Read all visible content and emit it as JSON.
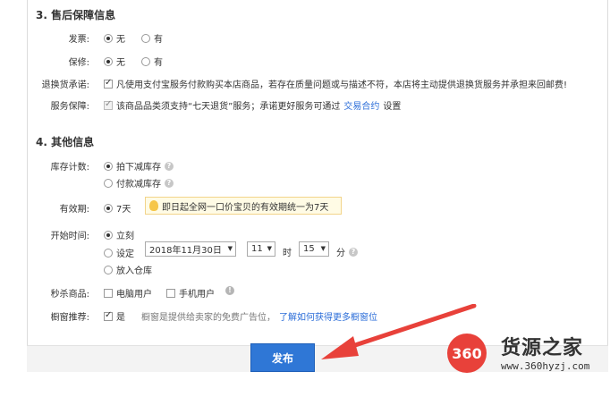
{
  "section3": {
    "title": "3. 售后保障信息",
    "invoice": {
      "label": "发票:",
      "opt_no": "无",
      "opt_yes": "有"
    },
    "warranty": {
      "label": "保修:",
      "opt_no": "无",
      "opt_yes": "有"
    },
    "return_promise": {
      "label": "退换货承诺:",
      "text": "凡使用支付宝服务付款购买本店商品，若存在质量问题或与描述不符，本店将主动提供退换货服务并承担来回邮费!"
    },
    "service": {
      "label": "服务保障:",
      "text_before": "该商品品类须支持“七天退货”服务；承诺更好服务可通过",
      "link": "交易合约",
      "text_after": "设置"
    }
  },
  "section4": {
    "title": "4. 其他信息",
    "stock": {
      "label": "库存计数:",
      "opt1": "拍下减库存",
      "opt2": "付款减库存"
    },
    "validity": {
      "label": "有效期:",
      "opt": "7天",
      "tip": "即日起全网一口价宝贝的有效期统一为7天"
    },
    "start_time": {
      "label": "开始时间:",
      "opt_now": "立刻",
      "opt_set": "设定",
      "date": "2018年11月30日",
      "hour": "11",
      "hour_unit": "时",
      "minute": "15",
      "minute_unit": "分",
      "opt_warehouse": "放入仓库"
    },
    "flash_sale": {
      "label": "秒杀商品:",
      "opt_pc": "电脑用户",
      "opt_mobile": "手机用户"
    },
    "window": {
      "label": "橱窗推荐:",
      "opt": "是",
      "desc": "橱窗是提供给卖家的免费广告位，",
      "link": "了解如何获得更多橱窗位"
    }
  },
  "footer": {
    "publish_label": "发布"
  },
  "watermark": {
    "logo": "360",
    "title": "货源之家",
    "url": "www.360hyzj.com"
  },
  "colors": {
    "primary_button": "#2f77d6",
    "link": "#2b6dd8",
    "arrow": "#e8413a",
    "tip_bg": "#fffbe5"
  }
}
